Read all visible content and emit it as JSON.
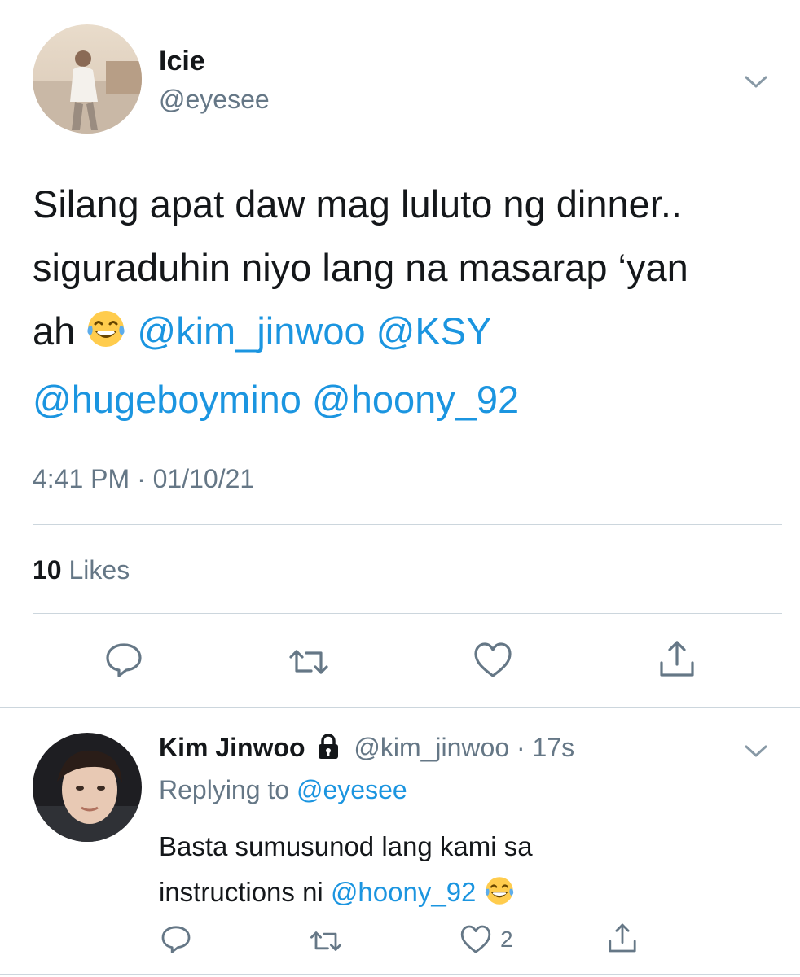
{
  "tweet": {
    "display_name": "Icie",
    "handle": "@eyesee",
    "text_1": "Silang apat daw mag luluto ng dinner..",
    "text_2": "siguraduhin niyo lang na masarap ‘yan",
    "text_3": "ah",
    "mention_1": "@kim_jinwoo",
    "mention_2": "@KSY",
    "mention_3": "@hugeboymino",
    "mention_4": "@hoony_92",
    "emoji": "face-with-tears-of-joy",
    "timestamp": "4:41 PM · 01/10/21",
    "likes_count": "10",
    "likes_label": "Likes"
  },
  "reply": {
    "display_name": "Kim Jinwoo",
    "handle": "@kim_jinwoo",
    "separator": "·",
    "time": "17s",
    "replying_label": "Replying to",
    "replying_to": "@eyesee",
    "text_1": "Basta sumusunod lang kami sa",
    "text_2": "instructions ni",
    "mention": "@hoony_92",
    "emoji": "face-with-tears-of-joy",
    "like_count": "2"
  },
  "colors": {
    "link": "#1b95e0",
    "muted": "#657786",
    "text": "#14171a",
    "divider": "#ccd6dd"
  },
  "icons": [
    "chevron-down-icon",
    "reply-icon",
    "retweet-icon",
    "heart-icon",
    "share-icon",
    "lock-icon"
  ]
}
